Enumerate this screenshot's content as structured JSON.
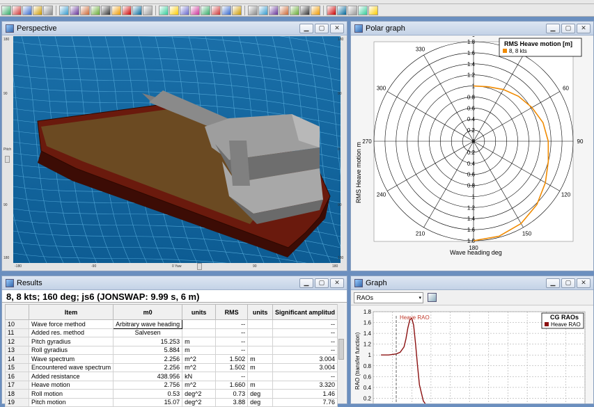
{
  "windows": {
    "perspective": {
      "title": "Perspective"
    },
    "polar": {
      "title": "Polar graph"
    },
    "results": {
      "title": "Results"
    },
    "graph": {
      "title": "Graph"
    }
  },
  "perspective_rulers": {
    "left": [
      "180",
      "90",
      "Pitch",
      "90",
      "180"
    ],
    "right": [
      "180",
      "90",
      "0",
      "90",
      "180"
    ],
    "bottom": [
      "-180",
      "-90",
      "0 Yaw",
      "90",
      "180"
    ]
  },
  "polar_chart": {
    "legend_title": "RMS Heave motion [m]",
    "legend_entry": "8, 8 kts",
    "ylabel": "RMS Heave motion  m",
    "xlabel": "Wave heading  deg",
    "radial_labels": [
      "1.8",
      "1.6",
      "1.4",
      "1.2",
      "1",
      "0.8",
      "0.6",
      "0.4",
      "0.2",
      "0"
    ],
    "radial_labels_lower": [
      "0.2",
      "0.4",
      "0.6",
      "0.8",
      "1",
      "1.2",
      "1.4",
      "1.6",
      "1.8"
    ],
    "angle_labels": [
      {
        "deg": 0,
        "text": "0"
      },
      {
        "deg": 30,
        "text": "30"
      },
      {
        "deg": 60,
        "text": "60"
      },
      {
        "deg": 90,
        "text": "90"
      },
      {
        "deg": 120,
        "text": "120"
      },
      {
        "deg": 150,
        "text": "150"
      },
      {
        "deg": 180,
        "text": "180"
      },
      {
        "deg": 210,
        "text": "210"
      },
      {
        "deg": 240,
        "text": "240"
      },
      {
        "deg": 270,
        "text": "270"
      },
      {
        "deg": 300,
        "text": "300"
      },
      {
        "deg": 330,
        "text": "330"
      }
    ],
    "rmax": 1.8,
    "series_color": "#f08a00",
    "series_heading_deg": [
      0,
      15,
      30,
      45,
      60,
      75,
      90,
      105,
      120,
      135,
      150,
      165,
      180
    ],
    "series_rms": [
      1.0,
      1.02,
      1.08,
      1.15,
      1.22,
      1.3,
      1.35,
      1.4,
      1.5,
      1.62,
      1.72,
      1.78,
      1.8
    ]
  },
  "results": {
    "header": "8, 8 kts; 160 deg; js6 (JONSWAP: 9.99 s, 6 m)",
    "columns": [
      "",
      "Item",
      "m0",
      "units",
      "RMS",
      "units",
      "Significant amplitud"
    ],
    "rows": [
      [
        "10",
        "Wave force method",
        "Arbitrary wave heading",
        "",
        "--",
        "",
        "--"
      ],
      [
        "11",
        "Added res. method",
        "Salvesen",
        "",
        "--",
        "",
        "--"
      ],
      [
        "12",
        "Pitch gyradius",
        "15.253",
        "m",
        "--",
        "",
        "--"
      ],
      [
        "13",
        "Roll gyradius",
        "5.884",
        "m",
        "--",
        "",
        "--"
      ],
      [
        "14",
        "Wave spectrum",
        "2.256",
        "m^2",
        "1.502",
        "m",
        "3.004"
      ],
      [
        "15",
        "Encountered wave spectrum",
        "2.256",
        "m^2",
        "1.502",
        "m",
        "3.004"
      ],
      [
        "16",
        "Added resistance",
        "438.956",
        "kN",
        "--",
        "",
        "--"
      ],
      [
        "17",
        "Heave motion",
        "2.756",
        "m^2",
        "1.660",
        "m",
        "3.320"
      ],
      [
        "18",
        "Roll motion",
        "0.53",
        "deg^2",
        "0.73",
        "deg",
        "1.46"
      ],
      [
        "19",
        "Pitch motion",
        "15.07",
        "deg^2",
        "3.88",
        "deg",
        "7.76"
      ]
    ]
  },
  "graph": {
    "select_value": "RAOs",
    "legend_title": "CG RAOs",
    "legend_entry": "Heave RAO",
    "annotation": "Heave RAO",
    "ylabel": "RAO (transfer function)",
    "series_color": "#8b1010"
  },
  "chart_data": {
    "type": "line",
    "title": "CG RAOs",
    "xlabel": "",
    "ylabel": "RAO (transfer function)",
    "xlim": [
      0,
      5.5
    ],
    "ylim": [
      0,
      1.8
    ],
    "x_ticks": [
      "0",
      "0.5",
      "1",
      "1.5",
      "2",
      "2.5",
      "3",
      "3.5",
      "4",
      "4.5",
      "5",
      "5.5"
    ],
    "y_ticks": [
      "0",
      "0.2",
      "0.4",
      "0.6",
      "0.8",
      "1",
      "1.2",
      "1.4",
      "1.6",
      "1.8"
    ],
    "series": [
      {
        "name": "Heave RAO",
        "x": [
          0.2,
          0.4,
          0.6,
          0.7,
          0.8,
          0.85,
          0.9,
          0.95,
          1.0,
          1.05,
          1.1,
          1.15,
          1.2,
          1.3,
          1.4,
          1.5,
          1.7,
          2.0,
          3.0,
          4.0,
          5.0,
          5.5
        ],
        "y": [
          1.0,
          1.0,
          1.02,
          1.05,
          1.15,
          1.3,
          1.5,
          1.65,
          1.68,
          1.55,
          1.2,
          0.8,
          0.45,
          0.15,
          0.05,
          0.02,
          0.01,
          0.0,
          0.0,
          0.0,
          0.0,
          0.0
        ]
      }
    ]
  }
}
